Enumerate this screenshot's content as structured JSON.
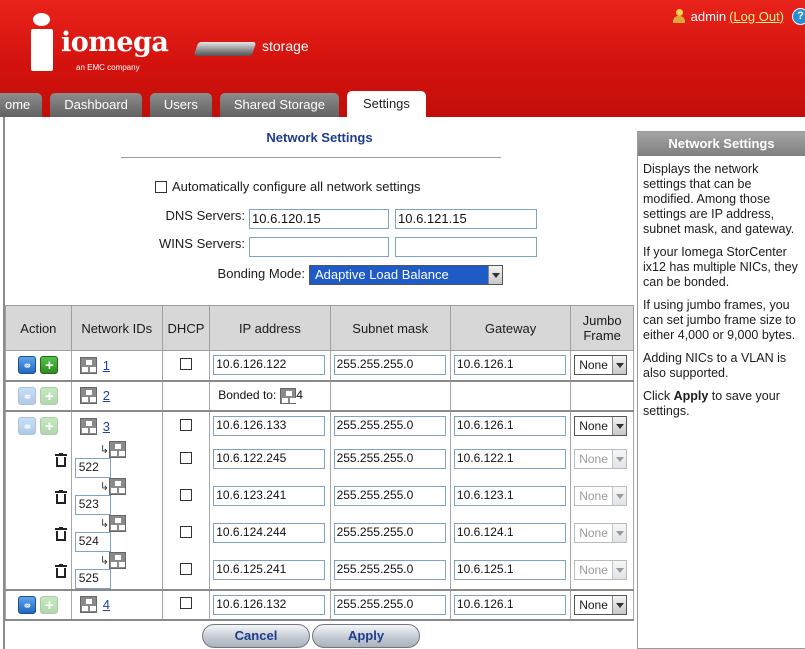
{
  "header": {
    "brand": "iomega",
    "brand_sub": "an EMC company",
    "device_label": "storage",
    "user": "admin",
    "logout": "(Log Out)"
  },
  "tabs": [
    "ome",
    "Dashboard",
    "Users",
    "Shared Storage",
    "Settings"
  ],
  "active_tab": "Settings",
  "page": {
    "title": "Network Settings",
    "auto_config_label": "Automatically configure all network settings",
    "dns_label": "DNS Servers:",
    "dns1": "10.6.120.15",
    "dns2": "10.6.121.15",
    "wins_label": "WINS Servers:",
    "wins1": "",
    "wins2": "",
    "bonding_label": "Bonding Mode:",
    "bonding_value": "Adaptive Load Balance"
  },
  "table": {
    "headers": {
      "action": "Action",
      "network_ids": "Network IDs",
      "dhcp": "DHCP",
      "ip": "IP address",
      "mask": "Subnet mask",
      "gateway": "Gateway",
      "jumbo": "Jumbo Frame"
    },
    "rows": [
      {
        "id": "1",
        "ip": "10.6.126.122",
        "mask": "255.255.255.0",
        "gateway": "10.6.126.1",
        "jumbo": "None"
      },
      {
        "id": "2",
        "bonded_label": "Bonded to:",
        "bonded_to": "4"
      },
      {
        "id": "3",
        "ip": "10.6.126.133",
        "mask": "255.255.255.0",
        "gateway": "10.6.126.1",
        "jumbo": "None"
      },
      {
        "vlan": "522",
        "ip": "10.6.122.245",
        "mask": "255.255.255.0",
        "gateway": "10.6.122.1",
        "jumbo": "None"
      },
      {
        "vlan": "523",
        "ip": "10.6.123.241",
        "mask": "255.255.255.0",
        "gateway": "10.6.123.1",
        "jumbo": "None"
      },
      {
        "vlan": "524",
        "ip": "10.6.124.244",
        "mask": "255.255.255.0",
        "gateway": "10.6.124.1",
        "jumbo": "None"
      },
      {
        "vlan": "525",
        "ip": "10.6.125.241",
        "mask": "255.255.255.0",
        "gateway": "10.6.125.1",
        "jumbo": "None"
      },
      {
        "id": "4",
        "ip": "10.6.126.132",
        "mask": "255.255.255.0",
        "gateway": "10.6.126.1",
        "jumbo": "None"
      }
    ]
  },
  "buttons": {
    "cancel": "Cancel",
    "apply": "Apply"
  },
  "side_panel": {
    "title": "Network Settings",
    "p1": "Displays the network settings that can be modified. Among those settings are IP address, subnet mask, and gateway.",
    "p2": "If your Iomega StorCenter ix12 has multiple NICs, they can be bonded.",
    "p3": "If using jumbo frames, you can set jumbo frame size to either 4,000 or 9,000 bytes.",
    "p4": "Adding NICs to a VLAN is also supported.",
    "p5_pre": "Click ",
    "p5_bold": "Apply",
    "p5_post": " to save your settings."
  },
  "colors": {
    "brand_red": "#d4120d",
    "title_blue": "#1e3d91",
    "link_blue": "#1d3fa6"
  }
}
